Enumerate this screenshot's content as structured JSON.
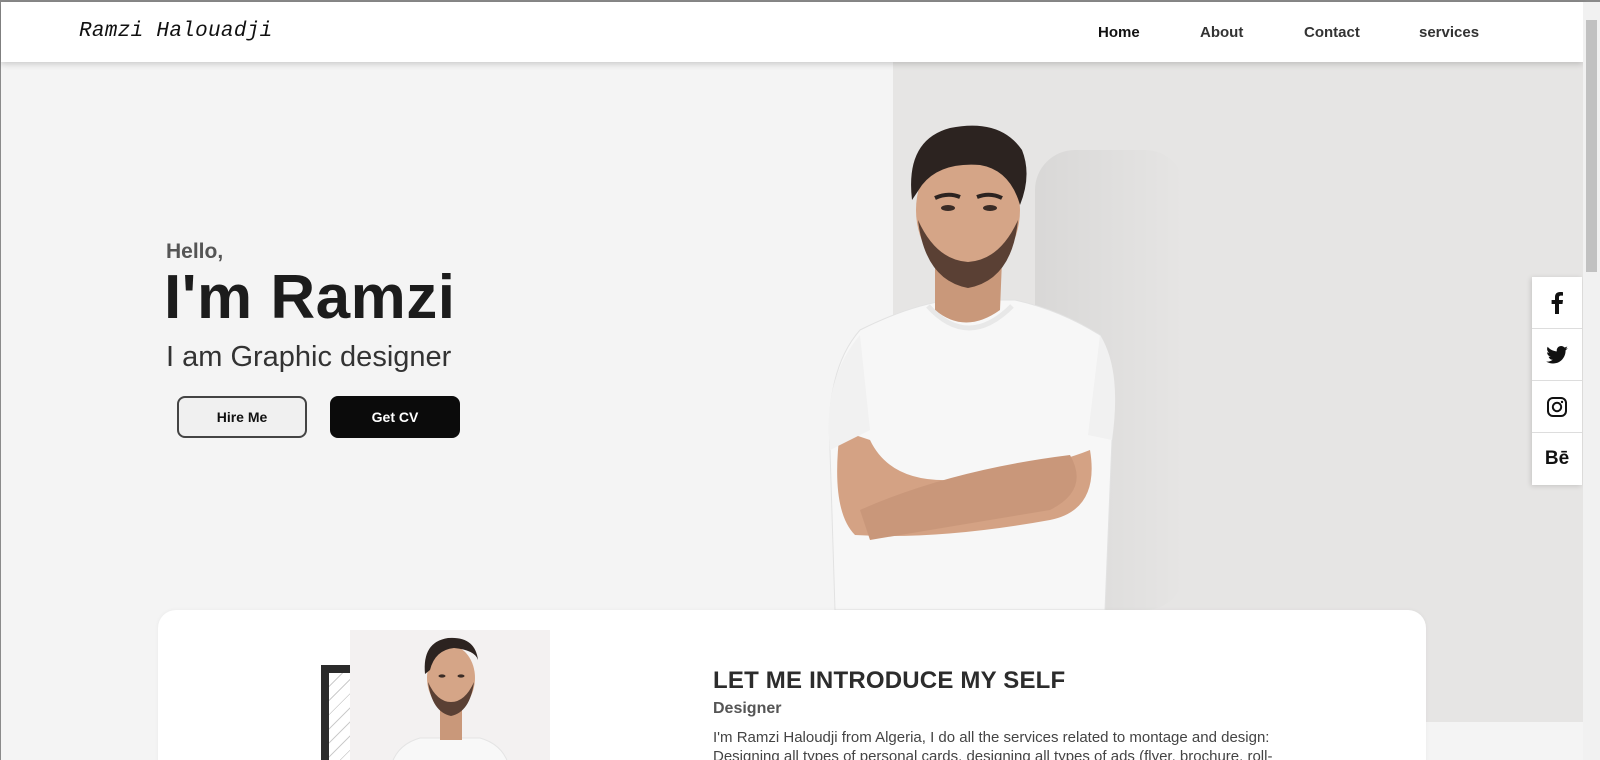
{
  "navbar": {
    "brand": "Ramzi Halouadji",
    "links": [
      "Home",
      "About",
      "Contact",
      "services"
    ],
    "active": "Home"
  },
  "hero": {
    "greeting": "Hello,",
    "name": "I'm Ramzi",
    "role": "I am Graphic designer",
    "hire_label": "Hire Me",
    "cv_label": "Get CV"
  },
  "social": {
    "icons": [
      "facebook-icon",
      "twitter-icon",
      "instagram-icon",
      "behance-icon"
    ],
    "behance_label": "Bē"
  },
  "intro": {
    "title": "LET ME INTRODUCE MY SELF",
    "subtitle": "Designer",
    "text": "I'm Ramzi Haloudji from Algeria, I do all the services related to montage and design: Designing all types of personal cards, designing all types of ads (flyer, brochure, roll-"
  },
  "colors": {
    "accent": "#0b0b0b",
    "hero_bg": "#f4f4f4",
    "hero_right_bg": "#e6e5e4"
  }
}
